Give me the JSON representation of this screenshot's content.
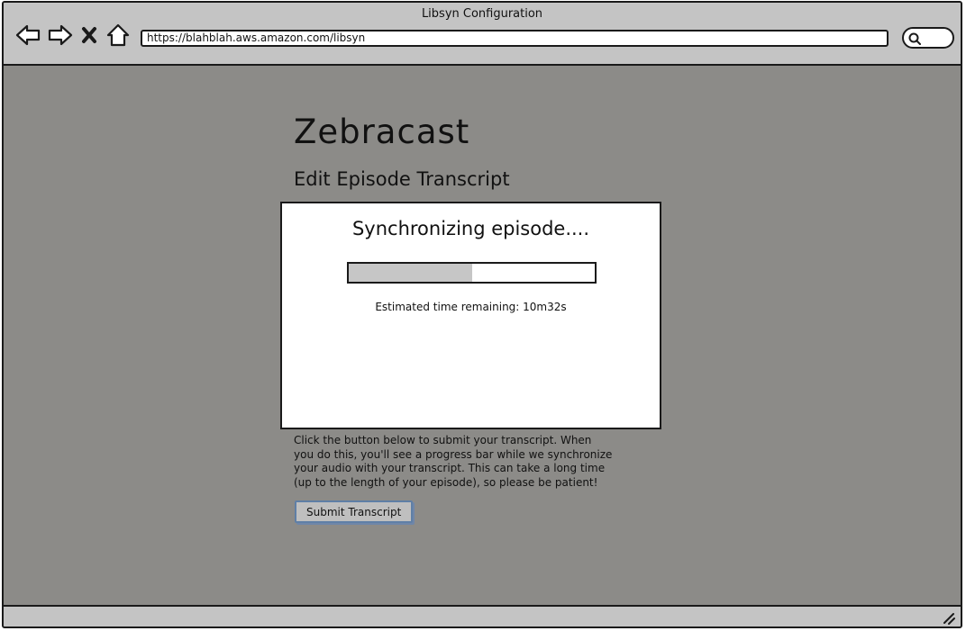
{
  "window": {
    "title": "Libsyn Configuration"
  },
  "browser": {
    "url": "https://blahblah.aws.amazon.com/libsyn",
    "icons": [
      "back-arrow-icon",
      "forward-arrow-icon",
      "close-icon",
      "home-icon",
      "search-icon",
      "resize-grip-icon"
    ]
  },
  "page": {
    "app_title": "Zebracast",
    "subtitle": "Edit Episode Transcript",
    "instructions": "Click the button below to submit your transcript. When you do this, you'll see a progress bar while we synchronize your audio with your transcript. This can take a long time (up to the length of your episode), so please be patient!",
    "submit_label": "Submit Transcript"
  },
  "modal": {
    "title": "Synchronizing episode....",
    "progress_percent": 50,
    "time_remaining": "Estimated time remaining: 10m32s"
  },
  "colors": {
    "content_background": "#8c8b88",
    "chrome_background": "#c4c4c4",
    "progress_fill": "#c6c6c6",
    "button_border": "#5f7fa6"
  }
}
